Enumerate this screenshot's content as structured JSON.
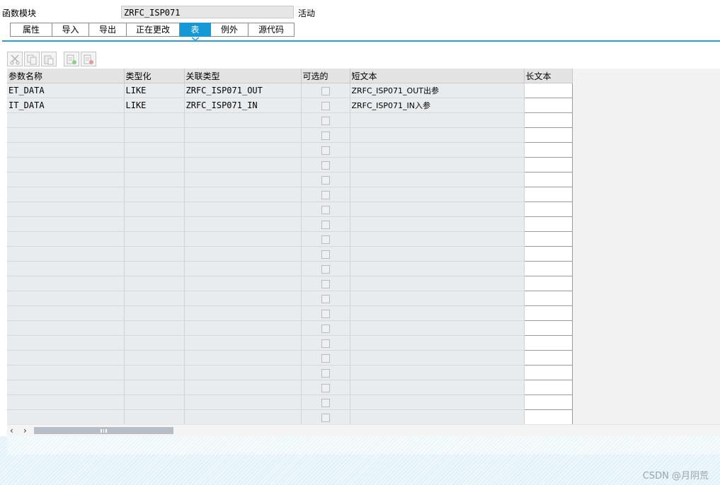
{
  "header": {
    "label": "函数模块",
    "name": "ZRFC_ISP071",
    "status": "活动"
  },
  "tabs": [
    {
      "label": "属性",
      "active": false
    },
    {
      "label": "导入",
      "active": false
    },
    {
      "label": "导出",
      "active": false
    },
    {
      "label": "正在更改",
      "active": false
    },
    {
      "label": "表",
      "active": true
    },
    {
      "label": "例外",
      "active": false
    },
    {
      "label": "源代码",
      "active": false
    }
  ],
  "toolbar": {
    "icons": [
      "cut-icon",
      "copy-icon",
      "paste-icon",
      "insert-row-icon",
      "delete-row-icon"
    ]
  },
  "table": {
    "columns": [
      "参数名称",
      "类型化",
      "关联类型",
      "可选的",
      "短文本",
      "长文本"
    ],
    "rows": [
      {
        "param": "ET_DATA",
        "typing": "LIKE",
        "ref_type": "ZRFC_ISP071_OUT",
        "optional": false,
        "short_text": "ZRFC_ISP071_OUT出参"
      },
      {
        "param": "IT_DATA",
        "typing": "LIKE",
        "ref_type": "ZRFC_ISP071_IN",
        "optional": false,
        "short_text": "ZRFC_ISP071_IN入参"
      }
    ],
    "empty_rows": 21
  },
  "colors": {
    "accent": "#1598d6",
    "tab_line": "#2a9fd6",
    "cell_bg": "#e9ecef"
  },
  "watermark": "CSDN @月阴荒"
}
